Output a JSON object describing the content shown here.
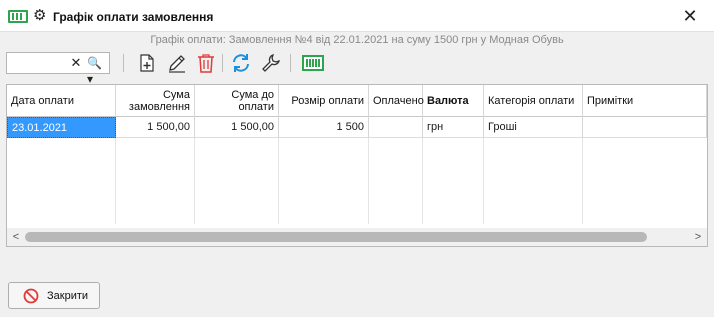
{
  "window": {
    "title": "Графік оплати замовлення",
    "close_glyph": "✕",
    "icons": [
      "money-icon",
      "gear-icon"
    ]
  },
  "subtitle": "Графік оплати: Замовлення №4 від 22.01.2021 на суму 1500 грн у Модная Обувь",
  "toolbar": {
    "search_value": "",
    "search_placeholder": "",
    "clear_glyph": "✕",
    "search_mode_glyph": "🔍▾",
    "buttons": [
      "add-document",
      "edit-pencil",
      "delete-trash",
      "refresh",
      "settings-wrench",
      "money"
    ]
  },
  "grid": {
    "columns": [
      {
        "label": "Дата оплати",
        "align": "left"
      },
      {
        "label": "Сума замовлення",
        "align": "right"
      },
      {
        "label": "Сума до оплати",
        "align": "right"
      },
      {
        "label": "Розмір оплати",
        "align": "right"
      },
      {
        "label": "Оплачено",
        "align": "left"
      },
      {
        "label": "Валюта",
        "align": "left",
        "bold": true
      },
      {
        "label": "Категорія оплати",
        "align": "left"
      },
      {
        "label": "Примітки",
        "align": "left"
      }
    ],
    "rows": [
      [
        "23.01.2021",
        "1 500,00",
        "1 500,00",
        "1 500",
        "",
        "грн",
        "Гроші",
        ""
      ]
    ],
    "scroll_left_glyph": "<",
    "scroll_right_glyph": ">"
  },
  "footer": {
    "close_label": "Закрити"
  },
  "colors": {
    "accent_green": "#2ea44f",
    "selection_blue": "#3399ff",
    "delete_red": "#e03a3a",
    "refresh_blue": "#1e8fdc"
  }
}
